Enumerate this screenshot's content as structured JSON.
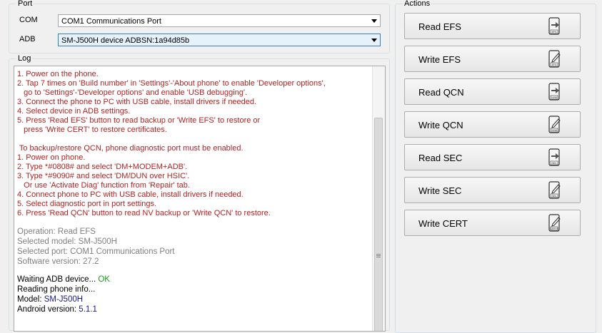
{
  "port": {
    "legend": "Port",
    "com_label": "COM",
    "com_value": "COM1 Communications Port",
    "adb_label": "ADB",
    "adb_value": "SM-J500H device ADBSN:1a94d85b"
  },
  "log": {
    "legend": "Log",
    "lines": [
      {
        "text": "1. Power on the phone.",
        "style": "red"
      },
      {
        "text": "2. Tap 7 times on 'Build number' in 'Settings'-'About phone' to enable 'Developer options',",
        "style": "red"
      },
      {
        "text": "   go to 'Settings'-'Developer options' and enable 'USB debugging'.",
        "style": "red"
      },
      {
        "text": "3. Connect the phone to PC with USB cable, install drivers if needed.",
        "style": "red"
      },
      {
        "text": "4. Select device in ADB settings.",
        "style": "red"
      },
      {
        "text": "5. Press 'Read EFS' button to read backup or 'Write EFS' to restore or",
        "style": "red"
      },
      {
        "text": "   press 'Write CERT' to restore certificates.",
        "style": "red"
      },
      {
        "text": "",
        "style": "red"
      },
      {
        "text": " To backup/restore QCN, phone diagnostic port must be enabled.",
        "style": "red"
      },
      {
        "text": "1. Power on phone.",
        "style": "red"
      },
      {
        "text": "2. Type *#0808# and select 'DM+MODEM+ADB'.",
        "style": "red"
      },
      {
        "text": "3. Type *#9090# and select 'DM/DUN over HSIC'.",
        "style": "red"
      },
      {
        "text": "   Or use 'Activate Diag' function from 'Repair' tab.",
        "style": "red"
      },
      {
        "text": "4. Connect phone to PC with USB cable, install drivers if needed.",
        "style": "red"
      },
      {
        "text": "5. Select diagnostic port in port settings.",
        "style": "red"
      },
      {
        "text": "6. Press 'Read QCN' button to read NV backup or 'Write QCN' to restore.",
        "style": "red"
      }
    ],
    "info": [
      "Operation: Read EFS",
      "Selected model: SM-J500H",
      "Selected port: COM1 Communications Port",
      "Software version: 27.2"
    ],
    "waiting_prefix": "Waiting ADB device... ",
    "waiting_ok": "OK",
    "reading": "Reading phone info...",
    "model_prefix": "Model: ",
    "model_value": "SM-J500H",
    "android_prefix": "Android version: ",
    "android_value": "5.1.1"
  },
  "actions": {
    "legend": "Actions",
    "buttons": [
      {
        "label": "Read EFS",
        "icon": "read-efs-icon",
        "badge": "EFS"
      },
      {
        "label": "Write EFS",
        "icon": "write-efs-icon",
        "badge": "EFS"
      },
      {
        "label": "Read QCN",
        "icon": "read-qcn-icon",
        "badge": "NVM"
      },
      {
        "label": "Write QCN",
        "icon": "write-qcn-icon",
        "badge": "NVM"
      },
      {
        "label": "Read SEC",
        "icon": "read-sec-icon",
        "badge": "SEC"
      },
      {
        "label": "Write SEC",
        "icon": "write-sec-icon",
        "badge": "SEC"
      },
      {
        "label": "Write CERT",
        "icon": "write-cert-icon",
        "badge": "CERTS"
      }
    ]
  },
  "colors": {
    "log_red": "#b22222",
    "ok_green": "#1a9a1a",
    "value_blue": "#1a1a8c"
  }
}
